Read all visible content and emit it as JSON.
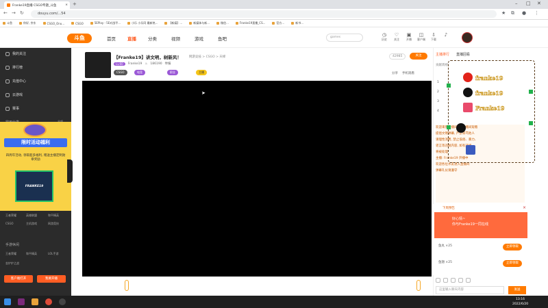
{
  "browser": {
    "tab_title": "Franke19直播 CSGO专题_斗鱼",
    "tab_close": "×",
    "new_tab": "+",
    "url": "douyu.com/...54",
    "bookmarks": [
      "斗鱼",
      "你好, 京东",
      "CSGO_Onu...",
      "CSGO",
      "5EPlay - 5E对战平...",
      "小乐 小乐同 最新热...",
      "【新媒】...",
      "新媒体与新...",
      "微信...",
      "Franke19直播_CS...",
      "官方...",
      "新书..."
    ]
  },
  "site": {
    "logo": "斗鱼",
    "nav": [
      "首页",
      "直播",
      "分类",
      "视频",
      "游戏",
      "鱼吧"
    ],
    "search_placeholder": "games",
    "header_icons": [
      "历史",
      "关注",
      "开播",
      "客户端",
      "下载"
    ]
  },
  "sidebar": {
    "items": [
      "我的关注",
      "排行榜",
      "充值中心",
      "云游戏",
      "赛事"
    ],
    "section": "常用分类",
    "section_more": "全部",
    "grid": [
      "王者荣耀",
      "英雄联盟",
      "和平精英",
      "CSGO",
      "主机游戏",
      "网游竞技"
    ],
    "promo_banner": "限时活动福利",
    "promo_sub": "四周年活动, 领取超多福利, 赠送主播定制勋章奖励",
    "promo_card": "FRANKE19",
    "section2": "手游休闲",
    "grid2": [
      "王者荣耀",
      "和平精英",
      "LOL手游",
      "金铲铲之战"
    ],
    "btn_client": "客户端打开",
    "btn_live": "我要开播"
  },
  "room": {
    "title": "【Franke19】讲文明，树新风！",
    "category": "网游竞技 > CSGO > 天梯",
    "follow_count": "42985",
    "follow_btn": "关注",
    "level": "Lv.60",
    "anchor": "Franke19",
    "fans": "186190",
    "report": "举报",
    "tags": [
      "CSGO",
      "电竞",
      "职业",
      "主播"
    ],
    "share": "分享",
    "mobile": "手机观看"
  },
  "right": {
    "tabs": [
      "主播排行",
      "直播回看"
    ],
    "sub": "贡献周榜",
    "ranks": [
      "1",
      "2",
      "3",
      "4"
    ],
    "brand": [
      "franke19",
      "franke19",
      "Franke19"
    ],
    "chat_lines": [
      "欢迎来到直播间, 本直播间观看",
      "提倡文明弹幕, 严禁辱骂他人",
      "请理性消费, 禁止低俗、暴力、",
      "谣言等违规内容, 如有违规",
      "将被处理",
      "主播: Franke19 开播中",
      "欢迎各位水友进入直播间",
      "弹幕礼仪请遵守"
    ]
  },
  "gift": {
    "title": "下周预告",
    "banner_line1": "好心情~",
    "banner_line2": "你与Franke19一同在线",
    "close": "×",
    "rows": [
      "鱼丸 ×25",
      "鱼翅 ×25"
    ],
    "row_btn": "立即领取",
    "input_placeholder": "这里输入聊天内容",
    "send": "发送"
  },
  "taskbar": {
    "time": "13:16",
    "date": "2022/6/20"
  }
}
